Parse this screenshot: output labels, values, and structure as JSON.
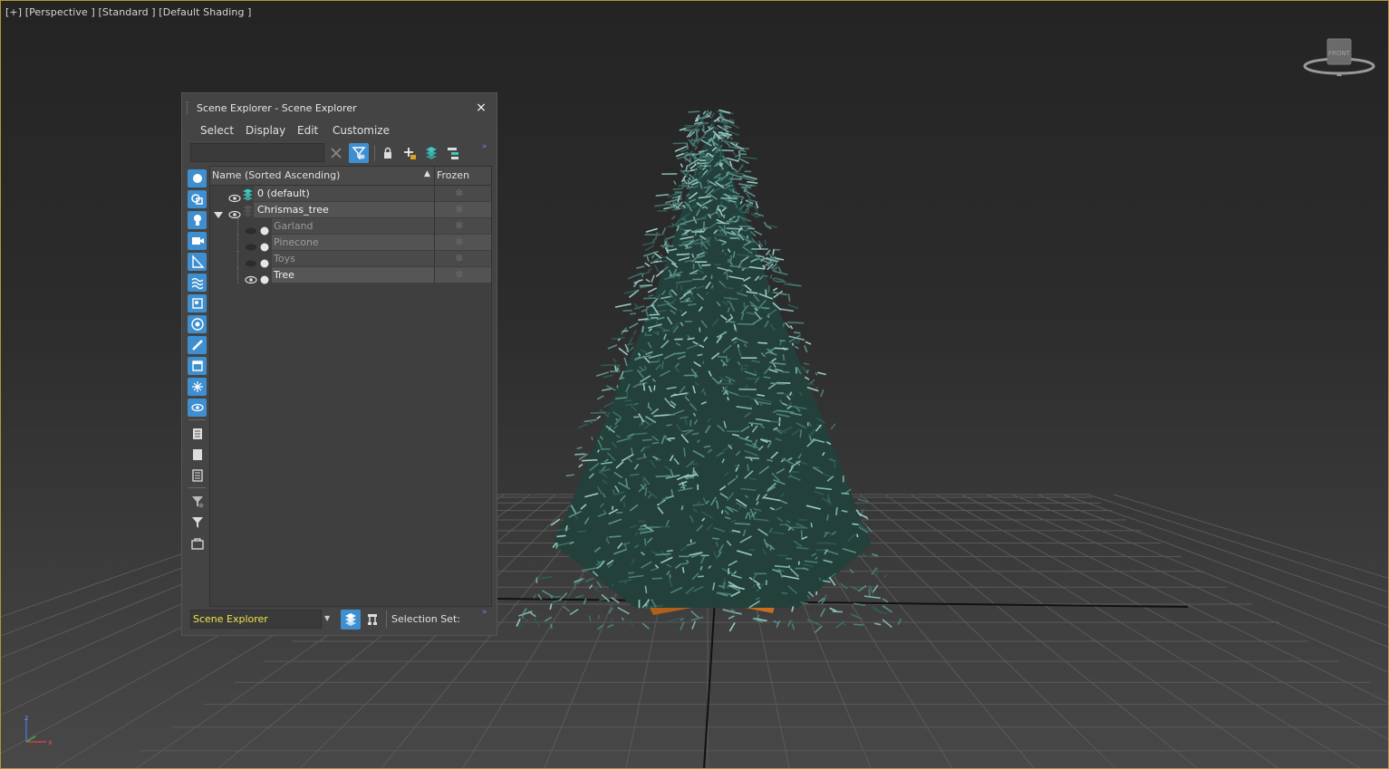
{
  "viewport": {
    "label": "[+] [Perspective ] [Standard ] [Default Shading ]",
    "viewcube_face": "FRONT",
    "axis": {
      "x": "x",
      "y": "y",
      "z": "z"
    }
  },
  "scene_explorer": {
    "title": "Scene Explorer - Scene Explorer",
    "close_icon": "×",
    "menu": [
      "Select",
      "Display",
      "Edit",
      "Customize"
    ],
    "search_value": "",
    "toolbar_icons": [
      "clear-icon",
      "filter-icon",
      "lock-icon",
      "add-layer-icon",
      "layers-icon",
      "hierarchy-icon"
    ],
    "columns": {
      "name": "Name (Sorted Ascending)",
      "sort_indicator": "▲",
      "frozen": "Frozen"
    },
    "rows": [
      {
        "name": "0 (default)",
        "type": "layer",
        "visible": true,
        "indent": 0,
        "expanded": false,
        "color": "#3cc8c0"
      },
      {
        "name": "Chrismas_tree",
        "type": "layer",
        "visible": true,
        "indent": 0,
        "expanded": true,
        "color": "#555555"
      },
      {
        "name": "Garland",
        "type": "object",
        "visible": false,
        "indent": 1
      },
      {
        "name": "Pinecone",
        "type": "object",
        "visible": false,
        "indent": 1
      },
      {
        "name": "Toys",
        "type": "object",
        "visible": false,
        "indent": 1
      },
      {
        "name": "Tree",
        "type": "object",
        "visible": true,
        "indent": 1
      }
    ],
    "frozen_icon": "❄",
    "bottom": {
      "explorer_name": "Scene Explorer",
      "selection_set_label": "Selection Set:"
    }
  },
  "colors": {
    "accent": "#3f8fd0",
    "viewport_border": "#b8962e",
    "dropdown_text": "#f2e24a"
  }
}
